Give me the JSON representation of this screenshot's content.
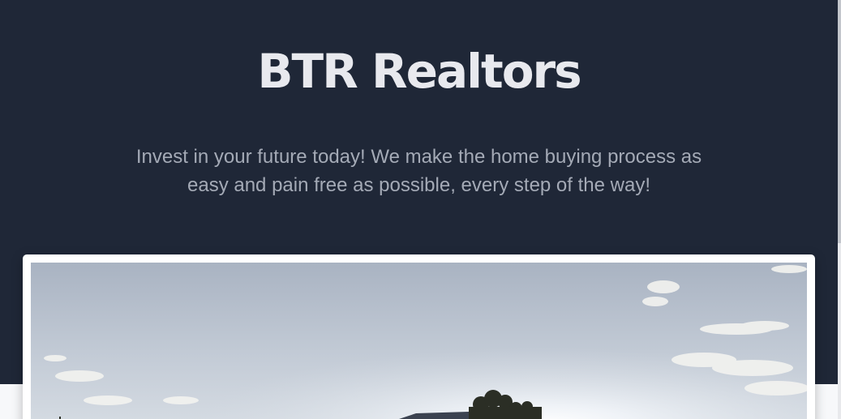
{
  "hero": {
    "title": "BTR Realtors",
    "subtitle": "Invest in your future today! We make the home buying process as easy and pain free as possible, every step of the way!"
  },
  "colors": {
    "hero_background": "#1f2737",
    "title_text": "#e8e9ee",
    "subtitle_text": "#a4aab6",
    "card_background": "#ffffff"
  }
}
